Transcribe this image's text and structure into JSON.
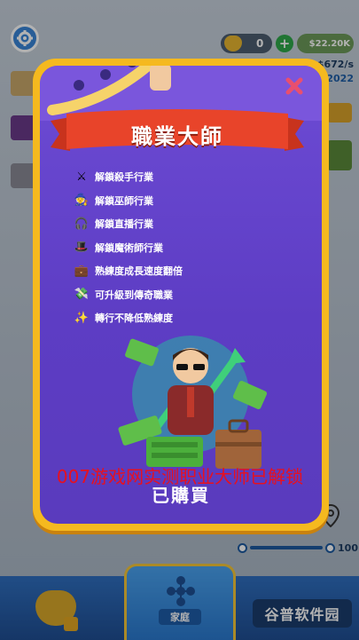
{
  "modal": {
    "title": "職業大師",
    "status": "已購買",
    "features": [
      {
        "icon": "crossed-swords-icon",
        "glyph": "⚔",
        "label": "解鎖殺手行業"
      },
      {
        "icon": "wizard-hat-icon",
        "glyph": "🧙",
        "label": "解鎖巫師行業"
      },
      {
        "icon": "headphones-icon",
        "glyph": "🎧",
        "label": "解鎖直播行業"
      },
      {
        "icon": "top-hat-icon",
        "glyph": "🎩",
        "label": "解鎖魔術師行業"
      },
      {
        "icon": "briefcase-icon",
        "glyph": "💼",
        "label": "熟練度成長速度翻倍"
      },
      {
        "icon": "money-stack-icon",
        "glyph": "💸",
        "label": "可升級到傳奇職業"
      },
      {
        "icon": "sparkles-icon",
        "glyph": "✨",
        "label": "轉行不降低熟練度"
      }
    ]
  },
  "overlay_caption": "007游戏网实测职业大师已解锁",
  "hud": {
    "heart_count": "0",
    "cash": "$22.20K",
    "income": "+$672/s",
    "year": "2022"
  },
  "dock": {
    "active_tab": "家庭"
  },
  "slider": {
    "value": "100"
  },
  "watermark": "谷普软件园",
  "colors": {
    "modal_border": "#f5b91f",
    "modal_inner": "#6d4bd4",
    "banner": "#e8442a",
    "caption": "#e8101e"
  }
}
